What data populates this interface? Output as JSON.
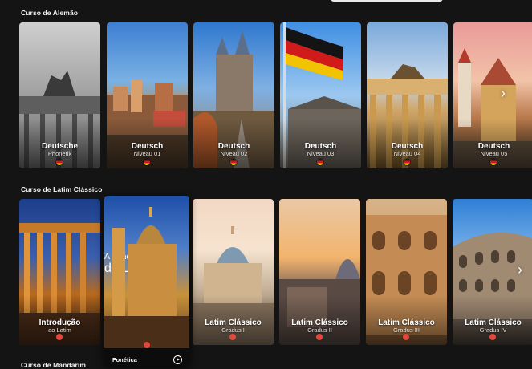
{
  "sections": [
    {
      "title": "Curso de Alemão",
      "cards": [
        {
          "title": "Deutsche",
          "sub": "Phonetik",
          "marker": "german-flag"
        },
        {
          "title": "Deutsch",
          "sub": "Niveau 01",
          "marker": "german-flag"
        },
        {
          "title": "Deutsch",
          "sub": "Niveau 02",
          "marker": "german-flag"
        },
        {
          "title": "Deutsch",
          "sub": "Niveau 03",
          "marker": "german-flag"
        },
        {
          "title": "Deutsch",
          "sub": "Niveau 04",
          "marker": "german-flag"
        },
        {
          "title": "Deutsch",
          "sub": "Niveau 05",
          "marker": "german-flag"
        }
      ]
    },
    {
      "title": "Curso de Latim Clássico",
      "cards": [
        {
          "title": "Introdução",
          "sub": "ao Latim",
          "marker": "red-dot"
        },
        {
          "title": "A Fonética",
          "sub": "do Latim",
          "marker": "red-dot"
        },
        {
          "title": "Latim Clássico",
          "sub": "Gradus I",
          "marker": "red-dot"
        },
        {
          "title": "Latim Clássico",
          "sub": "Gradus II",
          "marker": "red-dot"
        },
        {
          "title": "Latim Clássico",
          "sub": "Gradus III",
          "marker": "red-dot"
        },
        {
          "title": "Latim Clássico",
          "sub": "Gradus IV",
          "marker": "red-dot"
        }
      ]
    },
    {
      "title": "Curso de Mandarim"
    }
  ],
  "hover_card": {
    "bar_label": "Fonética"
  },
  "colors": {
    "accent_red": "#e0483c",
    "background": "#141414"
  }
}
